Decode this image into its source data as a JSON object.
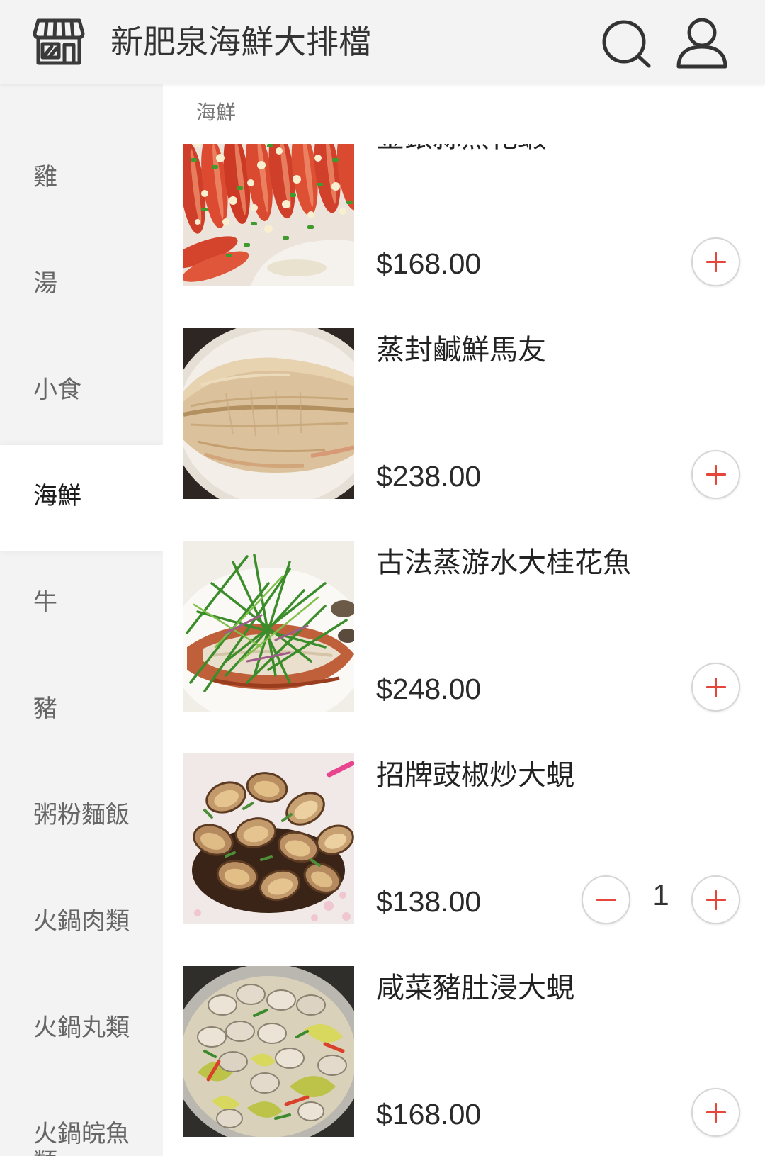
{
  "header": {
    "title": "新肥泉海鮮大排檔",
    "icons": {
      "store": "storefront-icon",
      "search": "search-icon",
      "account": "user-icon"
    }
  },
  "sidebar": {
    "items": [
      {
        "label": "雞"
      },
      {
        "label": "湯"
      },
      {
        "label": "小食"
      },
      {
        "label": "海鮮",
        "selected": true
      },
      {
        "label": "牛"
      },
      {
        "label": "豬"
      },
      {
        "label": "粥粉麵飯"
      },
      {
        "label": "火鍋肉類"
      },
      {
        "label": "火鍋丸類"
      },
      {
        "label": "火鍋皖魚類"
      }
    ]
  },
  "menu": {
    "category": "海鮮",
    "icons": {
      "add": "plus-icon",
      "remove": "minus-icon"
    },
    "items": [
      {
        "name": "金銀蒜蒸花蝦",
        "price": "$168.00"
      },
      {
        "name": "蒸封鹹鮮馬友",
        "price": "$238.00"
      },
      {
        "name": "古法蒸游水大桂花魚",
        "price": "$248.00"
      },
      {
        "name": "招牌豉椒炒大蜆",
        "price": "$138.00",
        "quantity": "1"
      },
      {
        "name": "咸菜豬肚浸大蜆",
        "price": "$168.00"
      }
    ]
  },
  "colors": {
    "accent": "#e4463b",
    "header_bg": "#f3f3f3",
    "sidebar_bg": "#f3f3f3",
    "button_border": "#d6d6d6"
  }
}
